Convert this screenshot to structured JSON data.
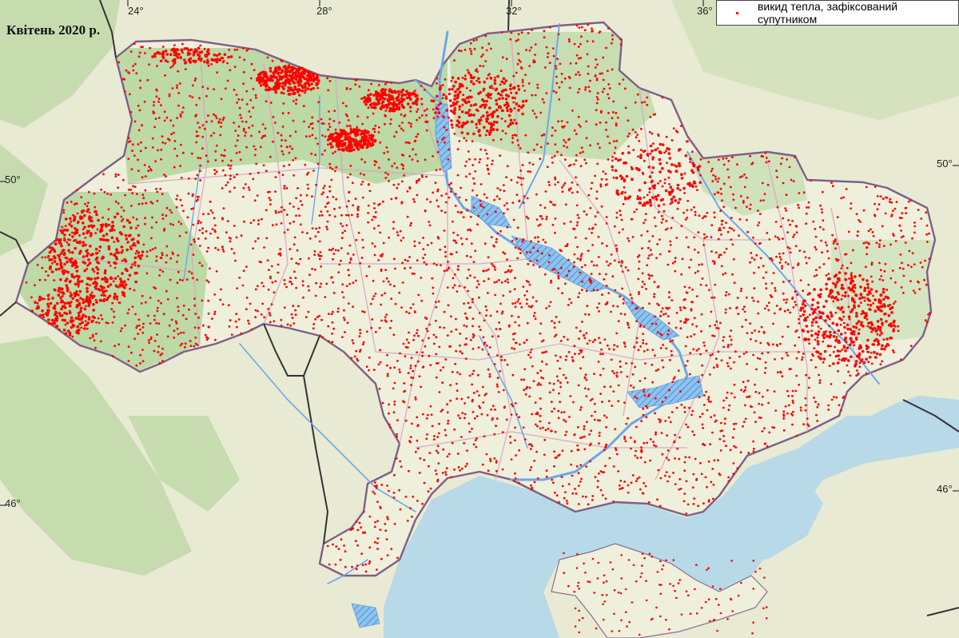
{
  "title": "Квітень 2020 р.",
  "legend": {
    "label": "викид тепла, зафіксований супутником",
    "color": "#ff0000"
  },
  "graticule": {
    "lon_labels": [
      "24°",
      "28°",
      "32°",
      "36°"
    ],
    "lat_labels": [
      "50°",
      "50°",
      "46°",
      "46°"
    ]
  },
  "colors": {
    "sea": "#b7d9e8",
    "land": "#eef0dc",
    "forest": "#bcd9a6",
    "border": "#7f5f86",
    "river": "#6ea6e8",
    "hotspot": "#ff0000"
  }
}
